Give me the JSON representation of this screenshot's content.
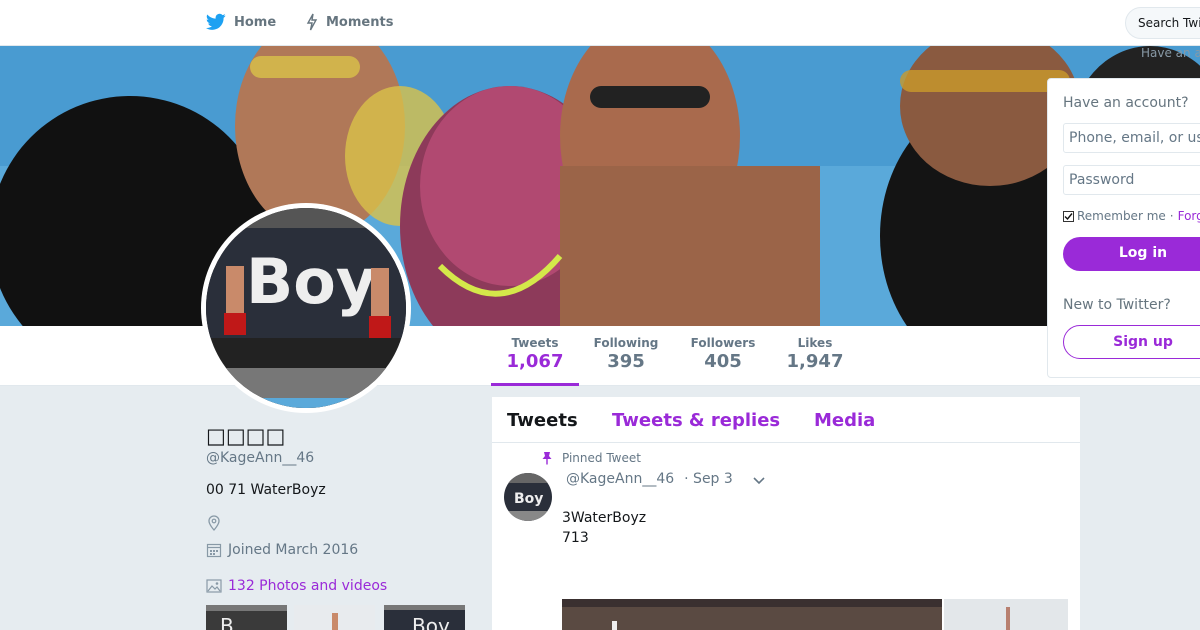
{
  "nav": {
    "home_label": "Home",
    "moments_label": "Moments",
    "search_placeholder": "Search Twi",
    "have_account_hint": "Have an a"
  },
  "profile": {
    "name": "□□□□",
    "handle": "@KageAnn__46",
    "bio": "00 71 WaterBoyz",
    "joined": "Joined March 2016",
    "photos_link": "132 Photos and videos"
  },
  "stats": [
    {
      "label": "Tweets",
      "value": "1,067"
    },
    {
      "label": "Following",
      "value": "395"
    },
    {
      "label": "Followers",
      "value": "405"
    },
    {
      "label": "Likes",
      "value": "1,947"
    }
  ],
  "timeline": {
    "tabs": [
      "Tweets",
      "Tweets & replies",
      "Media"
    ],
    "pinned_label": "Pinned Tweet",
    "tweet": {
      "handle": "@KageAnn__46",
      "date": "· Sep 3",
      "line1": "3WaterBoyz",
      "line2": "713"
    }
  },
  "login": {
    "question": "Have an account?",
    "username_placeholder": "Phone, email, or us",
    "password_placeholder": "Password",
    "remember": "Remember me",
    "separator": "·",
    "forgot": "Forg",
    "login_button": "Log in",
    "new_question": "New to Twitter?",
    "signup_button": "Sign up"
  },
  "colors": {
    "accent": "#9a2ad8",
    "twitter_blue": "#1da1f2",
    "background": "#e6ecf0"
  }
}
